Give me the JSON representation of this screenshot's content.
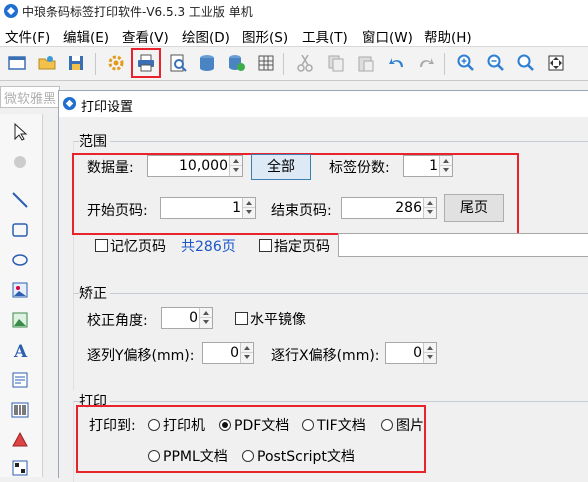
{
  "window": {
    "title": "中琅条码标签打印软件-V6.5.3 工业版 单机"
  },
  "menu": [
    "文件(F)",
    "编辑(E)",
    "查看(V)",
    "绘图(D)",
    "图形(S)",
    "工具(T)",
    "窗口(W)",
    "帮助(H)"
  ],
  "toolbar": {
    "icons": [
      "new-window-icon",
      "open-folder-icon",
      "save-icon",
      "settings-gear-icon",
      "print-icon",
      "print-preview-icon",
      "database-icon",
      "database-settings-icon",
      "grid-icon",
      "cut-icon",
      "copy-icon",
      "paste-icon",
      "undo-icon",
      "redo-icon",
      "zoom-in-icon",
      "zoom-out-icon",
      "zoom-fit-icon",
      "fit-page-icon"
    ],
    "highlighted": "print-icon"
  },
  "font_combo": {
    "value": "微软雅黑"
  },
  "left_tools": [
    "select-arrow-icon",
    "rotate-icon",
    "line-icon",
    "rectangle-icon",
    "ellipse-icon",
    "image-icon",
    "picture-icon",
    "text-icon",
    "paragraph-text-icon",
    "barcode-icon",
    "more-tools-icon",
    "shape-icon",
    "qrcode-icon"
  ],
  "dialog": {
    "title": "打印设置",
    "range": {
      "label": "范围",
      "data_count_label": "数据量:",
      "data_count_value": "10,000",
      "all_button": "全部",
      "copies_label": "标签份数:",
      "copies_value": "1",
      "start_page_label": "开始页码:",
      "start_page_value": "1",
      "end_page_label": "结束页码:",
      "end_page_value": "286",
      "last_page_button": "尾页",
      "remember_page_label": "记忆页码",
      "total_pages": "共286页",
      "specify_page_label": "指定页码"
    },
    "correction": {
      "label": "矫正",
      "angle_label": "校正角度:",
      "angle_value": "0",
      "mirror_label": "水平镜像",
      "col_y_offset_label": "逐列Y偏移(mm):",
      "col_y_offset_value": "0",
      "row_x_offset_label": "逐行X偏移(mm):",
      "row_x_offset_value": "0"
    },
    "print": {
      "label": "打印",
      "print_to_label": "打印到:",
      "options": [
        "打印机",
        "PDF文档",
        "TIF文档",
        "图片",
        "PPML文档",
        "PostScript文档"
      ],
      "selected": "PDF文档"
    }
  },
  "colors": {
    "highlight": "#e8232b",
    "accent_blue": "#1a56c8"
  }
}
